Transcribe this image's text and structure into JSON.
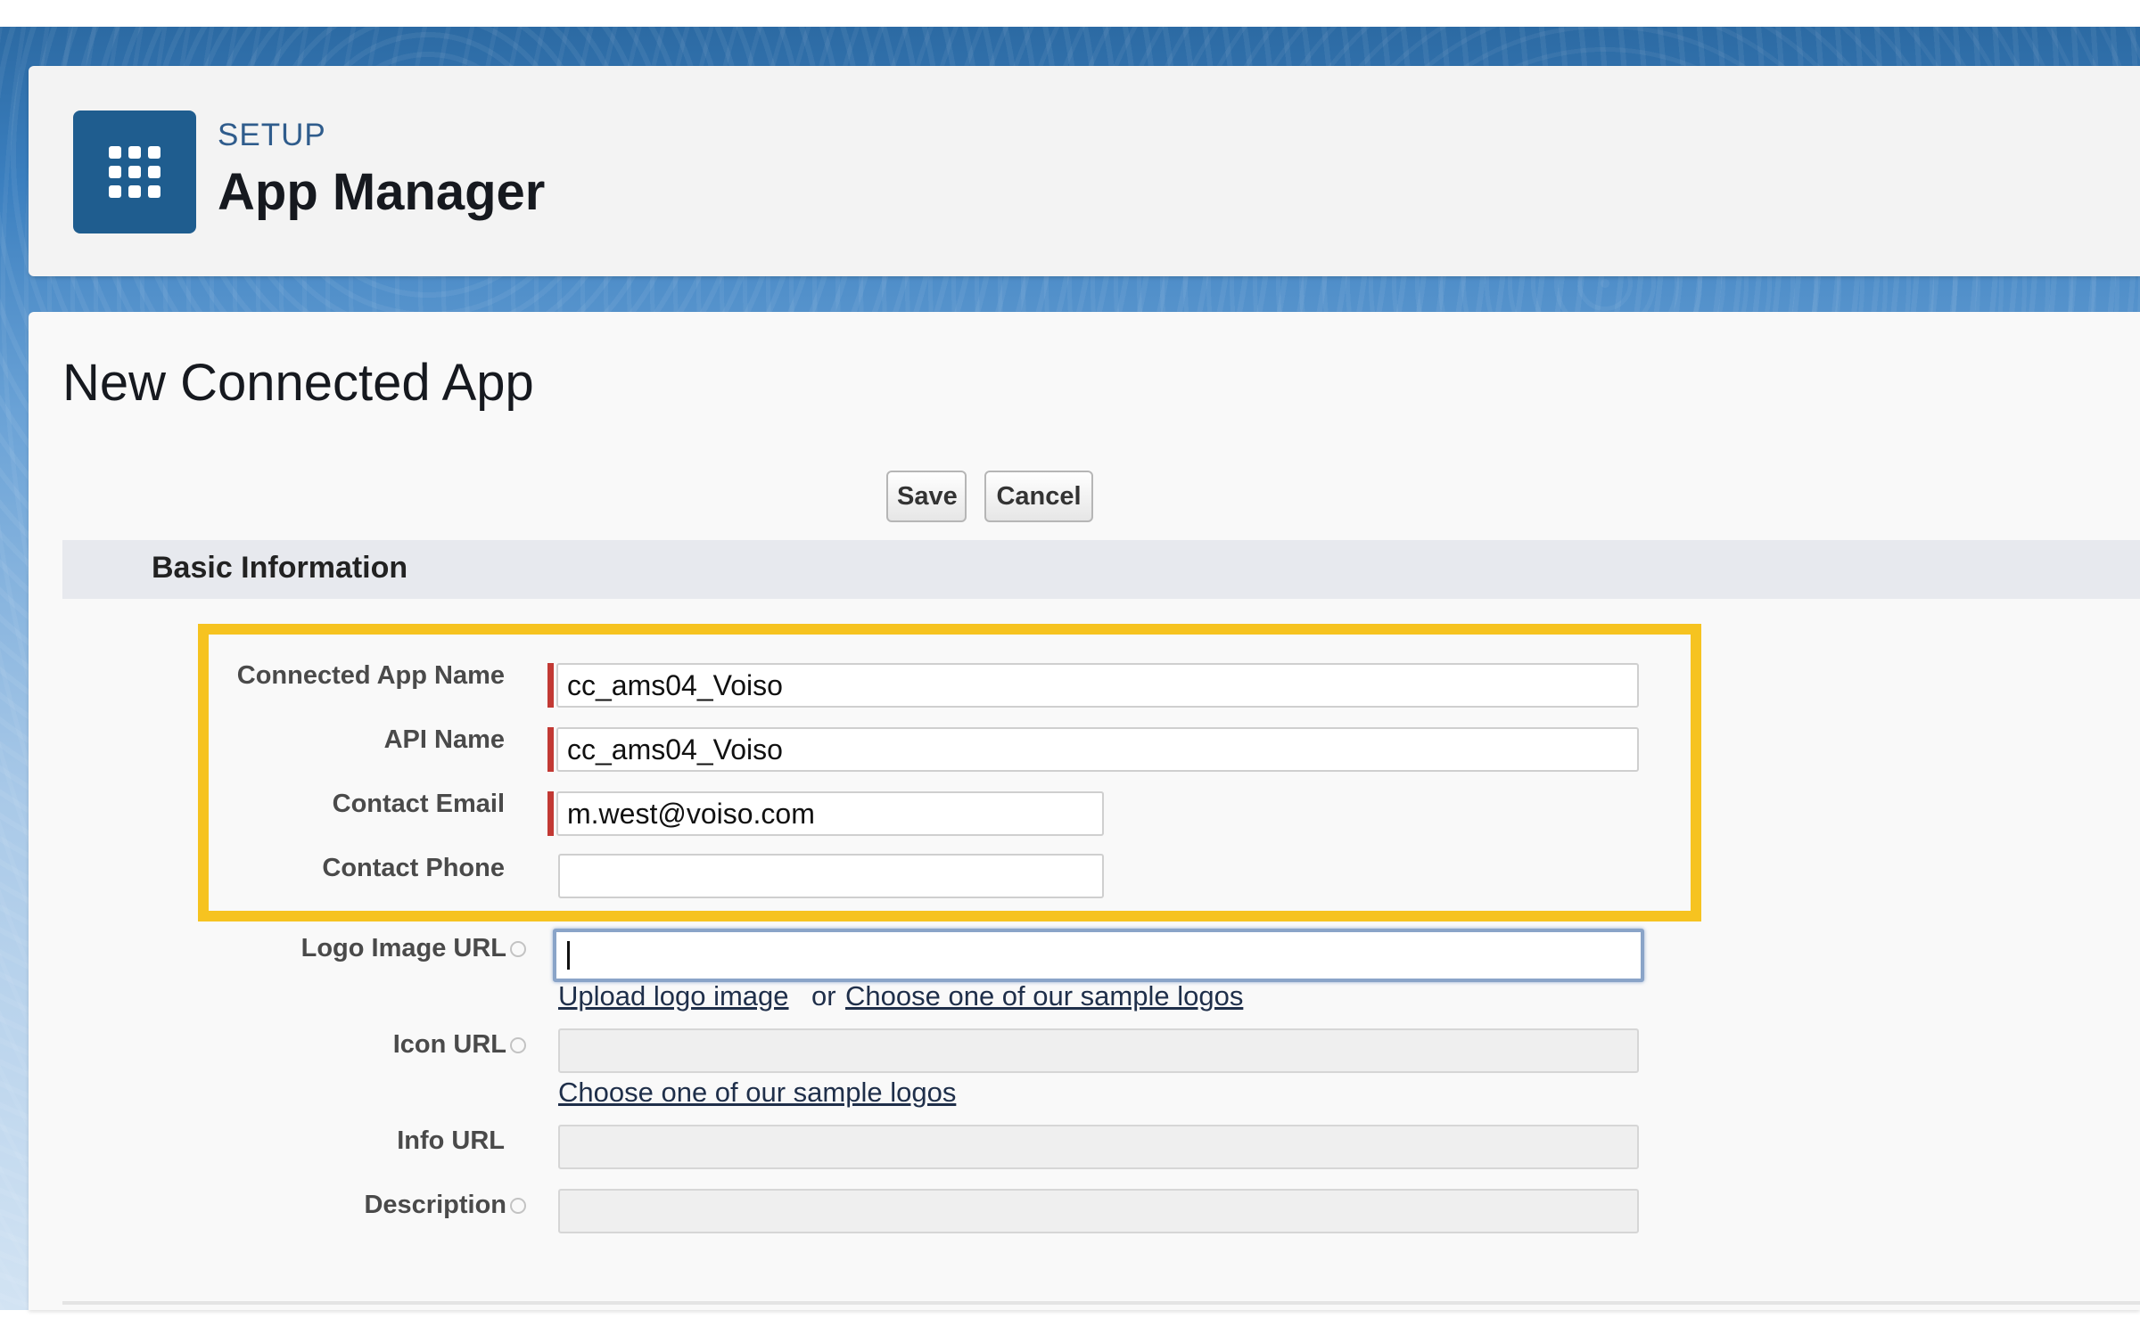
{
  "header": {
    "eyebrow": "SETUP",
    "title": "App Manager",
    "icon": "app-grid-icon"
  },
  "page": {
    "title": "New Connected App"
  },
  "toolbar": {
    "save_label": "Save",
    "cancel_label": "Cancel"
  },
  "section": {
    "title": "Basic Information"
  },
  "fields": {
    "connected_app_name": {
      "label": "Connected App Name",
      "value": "cc_ams04_Voiso",
      "required": true
    },
    "api_name": {
      "label": "API Name",
      "value": "cc_ams04_Voiso",
      "required": true
    },
    "contact_email": {
      "label": "Contact Email",
      "value": "m.west@voiso.com",
      "required": true
    },
    "contact_phone": {
      "label": "Contact Phone",
      "value": ""
    },
    "logo_image_url": {
      "label": "Logo Image URL",
      "value": ""
    },
    "icon_url": {
      "label": "Icon URL",
      "value": ""
    },
    "info_url": {
      "label": "Info URL",
      "value": ""
    },
    "description": {
      "label": "Description",
      "value": ""
    }
  },
  "links": {
    "upload_logo": "Upload logo image",
    "or": "or",
    "choose_sample_logos": "Choose one of our sample logos",
    "choose_sample_logos_icon": "Choose one of our sample logos"
  },
  "colors": {
    "highlight": "#f6c320",
    "required": "#c23934",
    "brand_icon": "#1f5d8f"
  }
}
